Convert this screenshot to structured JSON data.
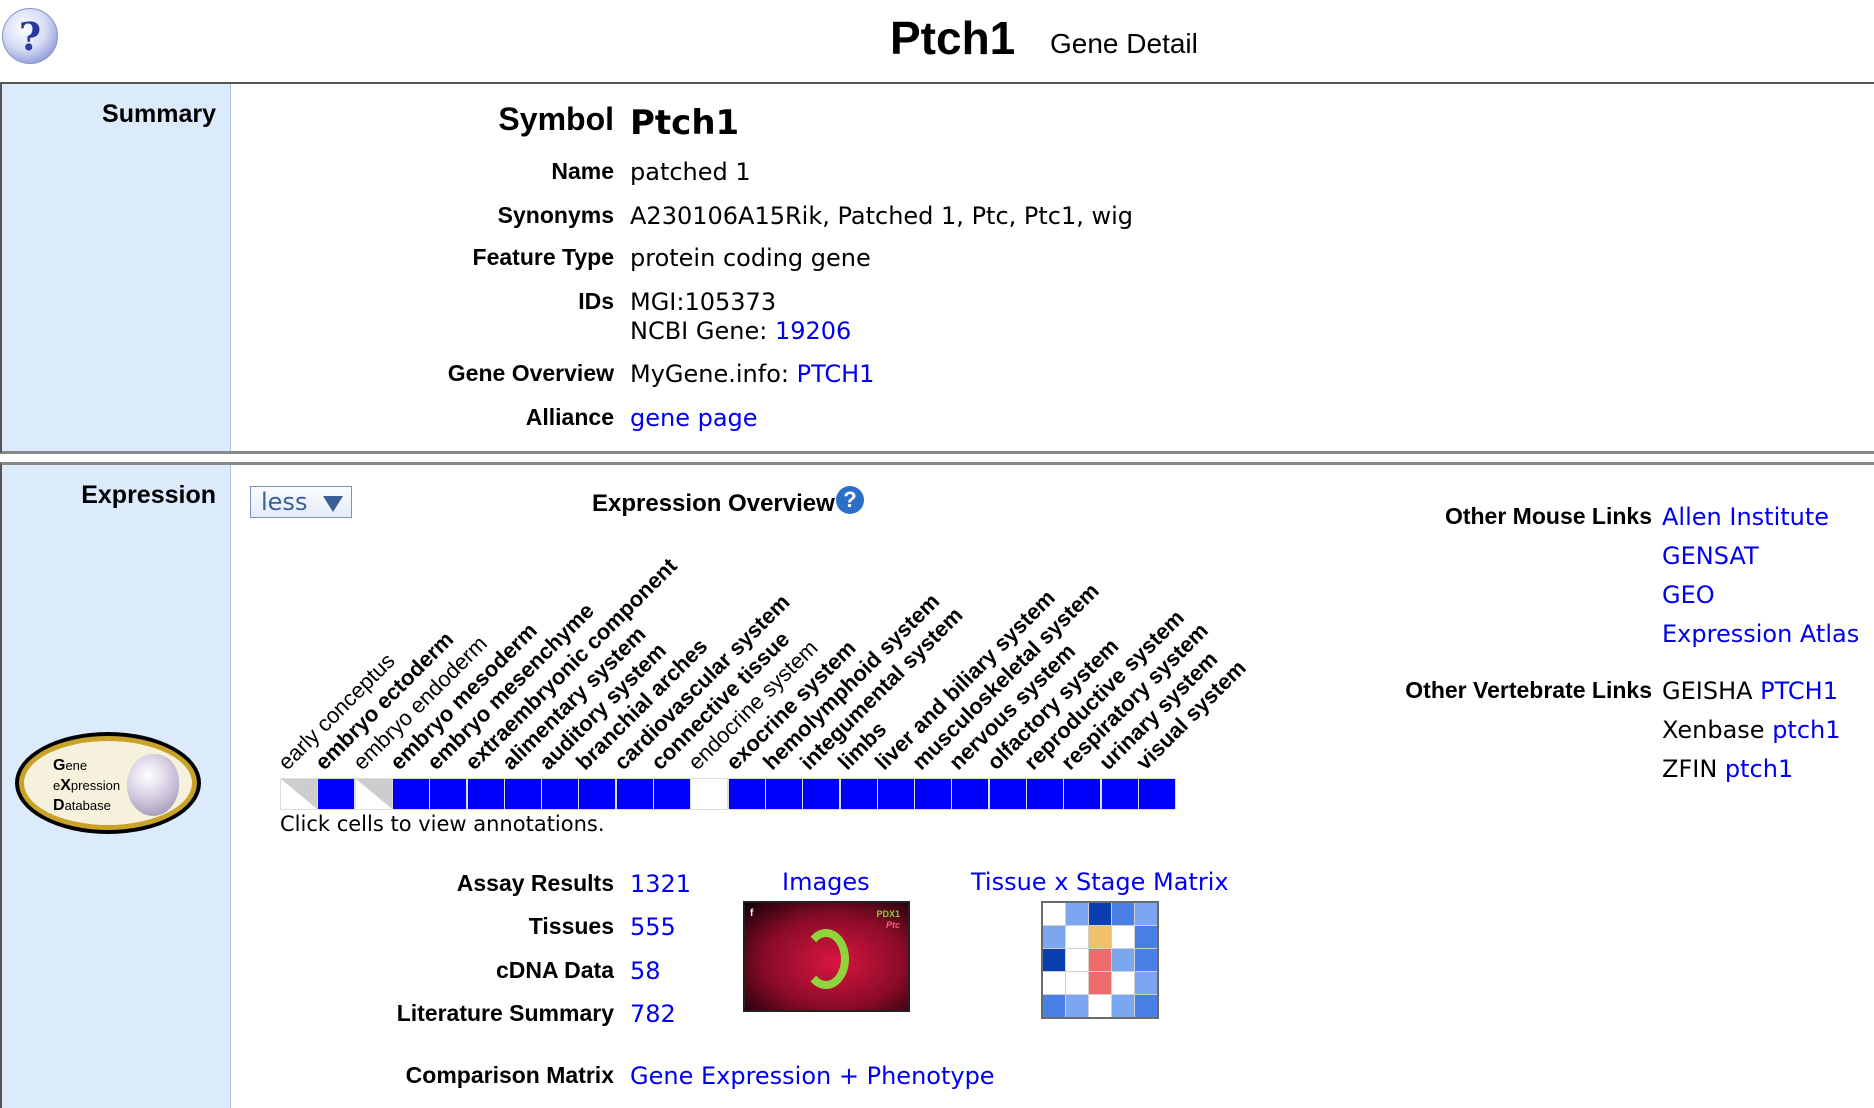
{
  "header": {
    "title": "Ptch1",
    "subtitle": "Gene Detail",
    "help_glyph": "?"
  },
  "summary": {
    "section_label": "Summary",
    "symbol_label": "Symbol",
    "symbol": "Ptch1",
    "name_label": "Name",
    "name": "patched 1",
    "synonyms_label": "Synonyms",
    "synonyms": "A230106A15Rik, Patched 1, Ptc, Ptc1, wig",
    "feature_type_label": "Feature Type",
    "feature_type": "protein coding gene",
    "ids_label": "IDs",
    "mgi_id": "MGI:105373",
    "ncbi_prefix": "NCBI Gene:",
    "ncbi_id": "19206",
    "gene_overview_label": "Gene Overview",
    "mygene_prefix": "MyGene.info:",
    "mygene_link": "PTCH1",
    "alliance_label": "Alliance",
    "alliance_link": "gene page"
  },
  "expression": {
    "section_label": "Expression",
    "toggle_label": "less",
    "overview_title": "Expression Overview",
    "help_glyph": "?",
    "ribbon_note": "Click cells to view annotations.",
    "ribbon": [
      {
        "label": "early conceptus",
        "state": "ambiguous"
      },
      {
        "label": "embryo ectoderm",
        "state": "detected"
      },
      {
        "label": "embryo endoderm",
        "state": "ambiguous"
      },
      {
        "label": "embryo mesoderm",
        "state": "detected"
      },
      {
        "label": "embryo mesenchyme",
        "state": "detected"
      },
      {
        "label": "extraembryonic component",
        "state": "detected"
      },
      {
        "label": "alimentary system",
        "state": "detected"
      },
      {
        "label": "auditory system",
        "state": "detected"
      },
      {
        "label": "branchial arches",
        "state": "detected"
      },
      {
        "label": "cardiovascular system",
        "state": "detected"
      },
      {
        "label": "connective tissue",
        "state": "detected"
      },
      {
        "label": "endocrine system",
        "state": "none"
      },
      {
        "label": "exocrine system",
        "state": "detected"
      },
      {
        "label": "hemolymphoid system",
        "state": "detected"
      },
      {
        "label": "integumental system",
        "state": "detected"
      },
      {
        "label": "limbs",
        "state": "detected"
      },
      {
        "label": "liver and biliary system",
        "state": "detected"
      },
      {
        "label": "musculoskeletal system",
        "state": "detected"
      },
      {
        "label": "nervous system",
        "state": "detected"
      },
      {
        "label": "olfactory system",
        "state": "detected"
      },
      {
        "label": "reproductive system",
        "state": "detected"
      },
      {
        "label": "respiratory system",
        "state": "detected"
      },
      {
        "label": "urinary system",
        "state": "detected"
      },
      {
        "label": "visual system",
        "state": "detected"
      }
    ],
    "logo": {
      "line1_cap": "G",
      "line1_rest": "ene",
      "line2_pre": "e",
      "line2_cap": "X",
      "line2_rest": "pression",
      "line3_cap": "D",
      "line3_rest": "atabase"
    },
    "assay_results_label": "Assay Results",
    "assay_results": "1321",
    "tissues_label": "Tissues",
    "tissues": "555",
    "cdna_label": "cDNA Data",
    "cdna": "58",
    "literature_label": "Literature Summary",
    "literature": "782",
    "comparison_label": "Comparison Matrix",
    "comparison_link": "Gene Expression + Phenotype",
    "images_label": "Images",
    "image_thumb": {
      "letter": "f",
      "badge1": "PDX1",
      "badge2": "Ptc"
    },
    "matrix_label": "Tissue x Stage Matrix",
    "matrix_cells": [
      "#ffffff",
      "#7aa7f0",
      "#0b3fb0",
      "#4a7fe6",
      "#7aa7f0",
      "#7aa7f0",
      "#ffffff",
      "#f3c06a",
      "#ffffff",
      "#4a7fe6",
      "#0b3fb0",
      "#ffffff",
      "#ef6a6a",
      "#7aa7f0",
      "#4a7fe6",
      "#ffffff",
      "#ffffff",
      "#ef6a6a",
      "#ffffff",
      "#7aa7f0",
      "#4a7fe6",
      "#7aa7f0",
      "#ffffff",
      "#7aa7f0",
      "#4a7fe6"
    ]
  },
  "links": {
    "other_mouse_label": "Other Mouse Links",
    "mouse_links": [
      "Allen Institute",
      "GENSAT",
      "GEO",
      "Expression Atlas"
    ],
    "other_vertebrate_label": "Other Vertebrate Links",
    "vertebrate_links": [
      {
        "source": "GEISHA",
        "link": "PTCH1"
      },
      {
        "source": "Xenbase",
        "link": "ptch1"
      },
      {
        "source": "ZFIN",
        "link": "ptch1"
      }
    ]
  },
  "colors": {
    "sidebar": "#dcebfb",
    "link": "#0000ee",
    "detected": "#0000ff",
    "ambiguous": "#cdcdcd"
  }
}
